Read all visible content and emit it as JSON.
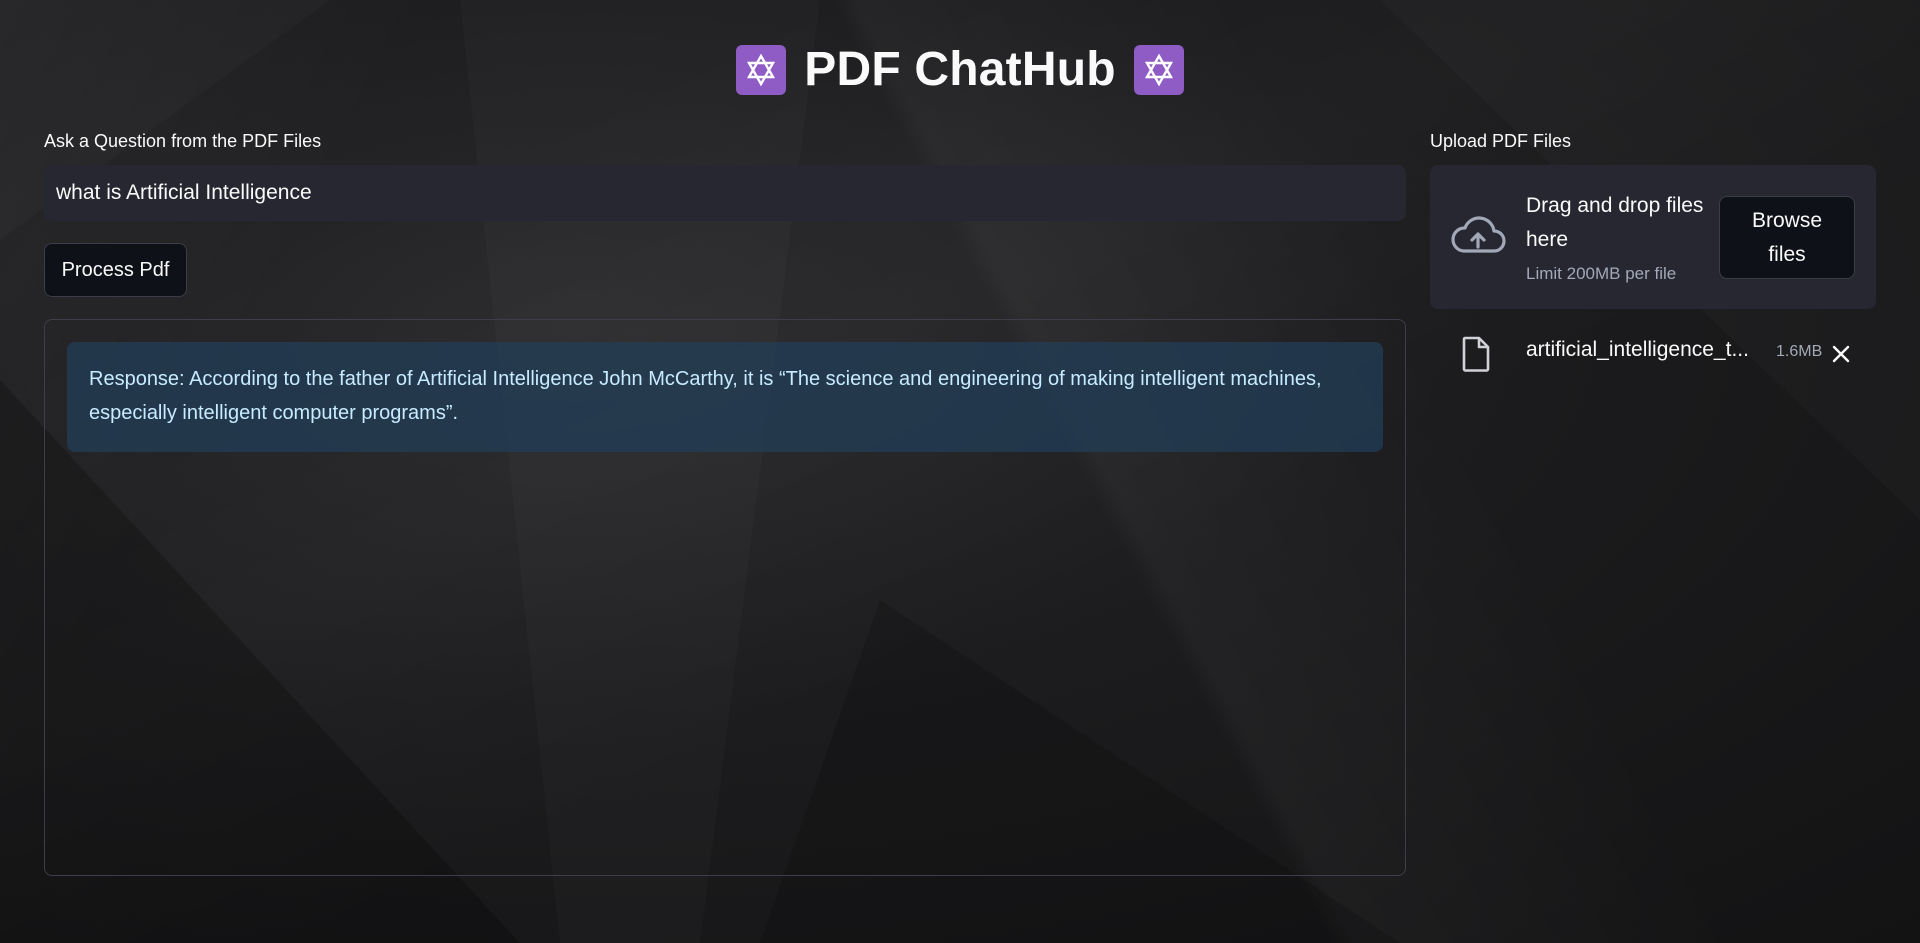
{
  "app": {
    "title": "PDF ChatHub"
  },
  "question": {
    "label": "Ask a Question from the PDF Files",
    "value": "what is Artificial Intelligence"
  },
  "process_button": {
    "label": "Process Pdf"
  },
  "response": {
    "text": "Response: According to the father of Artificial Intelligence John McCarthy, it is “The science and engineering of making intelligent machines, especially intelligent computer programs”."
  },
  "upload": {
    "label": "Upload PDF Files",
    "drop_line1": "Drag and drop files",
    "drop_line2": "here",
    "limit": "Limit 200MB per file",
    "browse_line1": "Browse",
    "browse_line2": "files"
  },
  "file": {
    "name": "artificial_intelligence_t...",
    "size": "1.6MB"
  },
  "colors": {
    "accent": "#8e5cc4",
    "response_text": "#c7ebff",
    "response_bg": "#233e58",
    "input_bg": "#262730"
  },
  "icons": [
    "star-of-david-icon",
    "cloud-upload-icon",
    "file-icon",
    "close-icon"
  ]
}
